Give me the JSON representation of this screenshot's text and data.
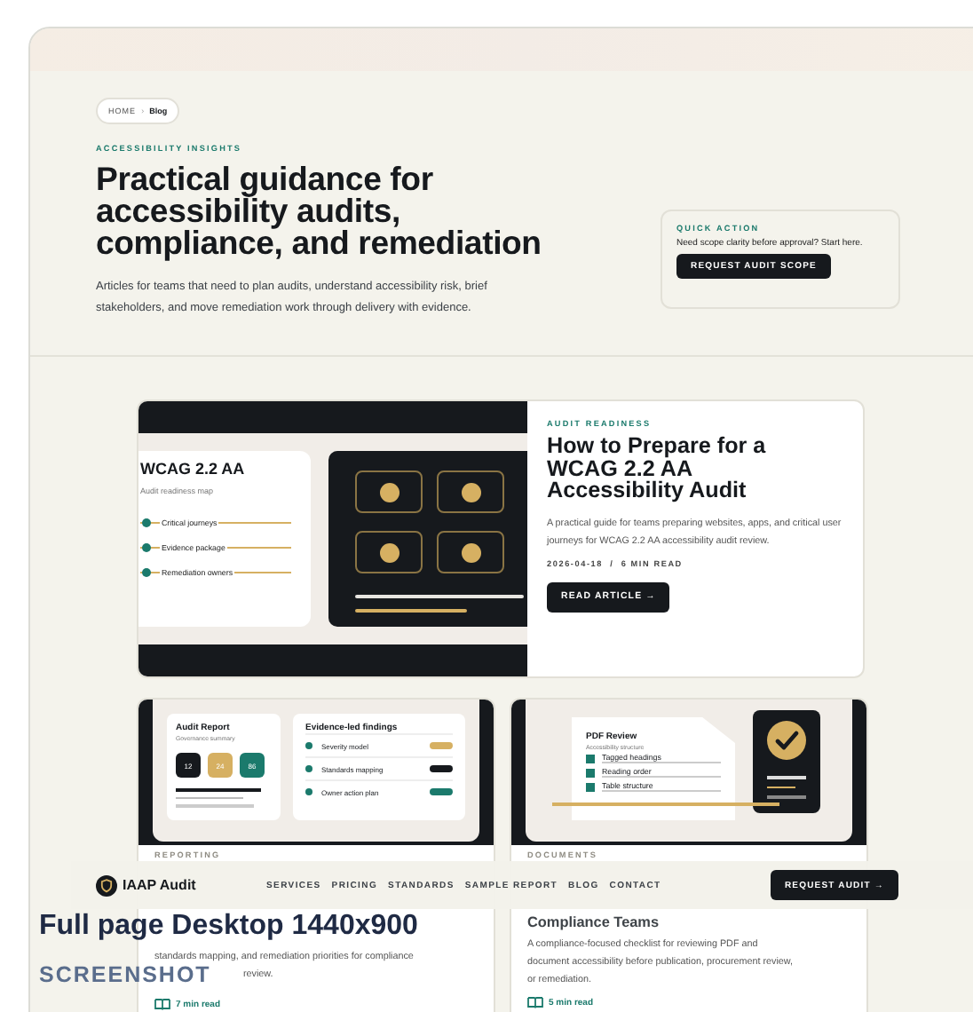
{
  "hero": {
    "breadcrumb": [
      {
        "label": "HOME",
        "selected": false
      },
      {
        "label": "Blog",
        "selected": true
      }
    ],
    "breadcrumb_separator": "›",
    "kicker": "ACCESSIBILITY INSIGHTS",
    "title": "Practical guidance for accessibility audits, compliance, and remediation",
    "intro": "Articles for teams that need to plan audits, understand accessibility risk, brief stakeholders, and move remediation work through delivery with evidence."
  },
  "quick_action": {
    "kicker": "QUICK ACTION",
    "text": "Need scope clarity before approval? Start here.",
    "button": "REQUEST AUDIT SCOPE"
  },
  "featured": {
    "illustration": {
      "title": "WCAG 2.2 AA",
      "subtitle": "Audit readiness map",
      "items": [
        "Critical journeys",
        "Evidence package",
        "Remediation owners"
      ]
    },
    "kicker": "AUDIT READINESS",
    "title": "How to Prepare for a WCAG 2.2 AA Accessibility Audit",
    "summary": "A practical guide for teams preparing websites, apps, and critical user journeys for WCAG 2.2 AA accessibility audit review.",
    "meta": "2026-04-18  /  6 MIN READ",
    "button": "READ ARTICLE →"
  },
  "cards": [
    {
      "kind": "report",
      "illustration": {
        "title": "Audit Report",
        "subtitle": "Governance summary",
        "tiles": [
          {
            "value": "12",
            "color": "#16191d"
          },
          {
            "value": "24",
            "color": "#d6b062"
          },
          {
            "value": "86",
            "color": "#1b7a6c"
          }
        ],
        "panel_title": "Evidence-led findings",
        "rows": [
          {
            "label": "Severity model",
            "color": "#d6b062"
          },
          {
            "label": "Standards mapping",
            "color": "#16191d"
          },
          {
            "label": "Owner action plan",
            "color": "#1b7a6c"
          }
        ]
      },
      "kicker": "REPORTING",
      "summary_lines": [
        "standards mapping, and remediation priorities for compliance",
        "review."
      ],
      "read_time": "7 min read"
    },
    {
      "kind": "pdf",
      "illustration": {
        "title": "PDF Review",
        "subtitle": "Accessibility structure",
        "items": [
          "Tagged headings",
          "Reading order",
          "Table structure"
        ]
      },
      "kicker": "DOCUMENTS",
      "title": "Compliance Teams",
      "summary_lines": [
        "A compliance-focused checklist for reviewing PDF and",
        "document accessibility before publication, procurement review,",
        "or remediation."
      ],
      "read_time": "5 min read"
    }
  ],
  "nav": {
    "brand": "IAAP Audit",
    "links": [
      "SERVICES",
      "PRICING",
      "STANDARDS",
      "SAMPLE REPORT",
      "BLOG",
      "CONTACT"
    ],
    "button": "REQUEST AUDIT →"
  },
  "caption": {
    "title": "Full page Desktop 1440x900",
    "subtitle": "SCREENSHOT"
  }
}
